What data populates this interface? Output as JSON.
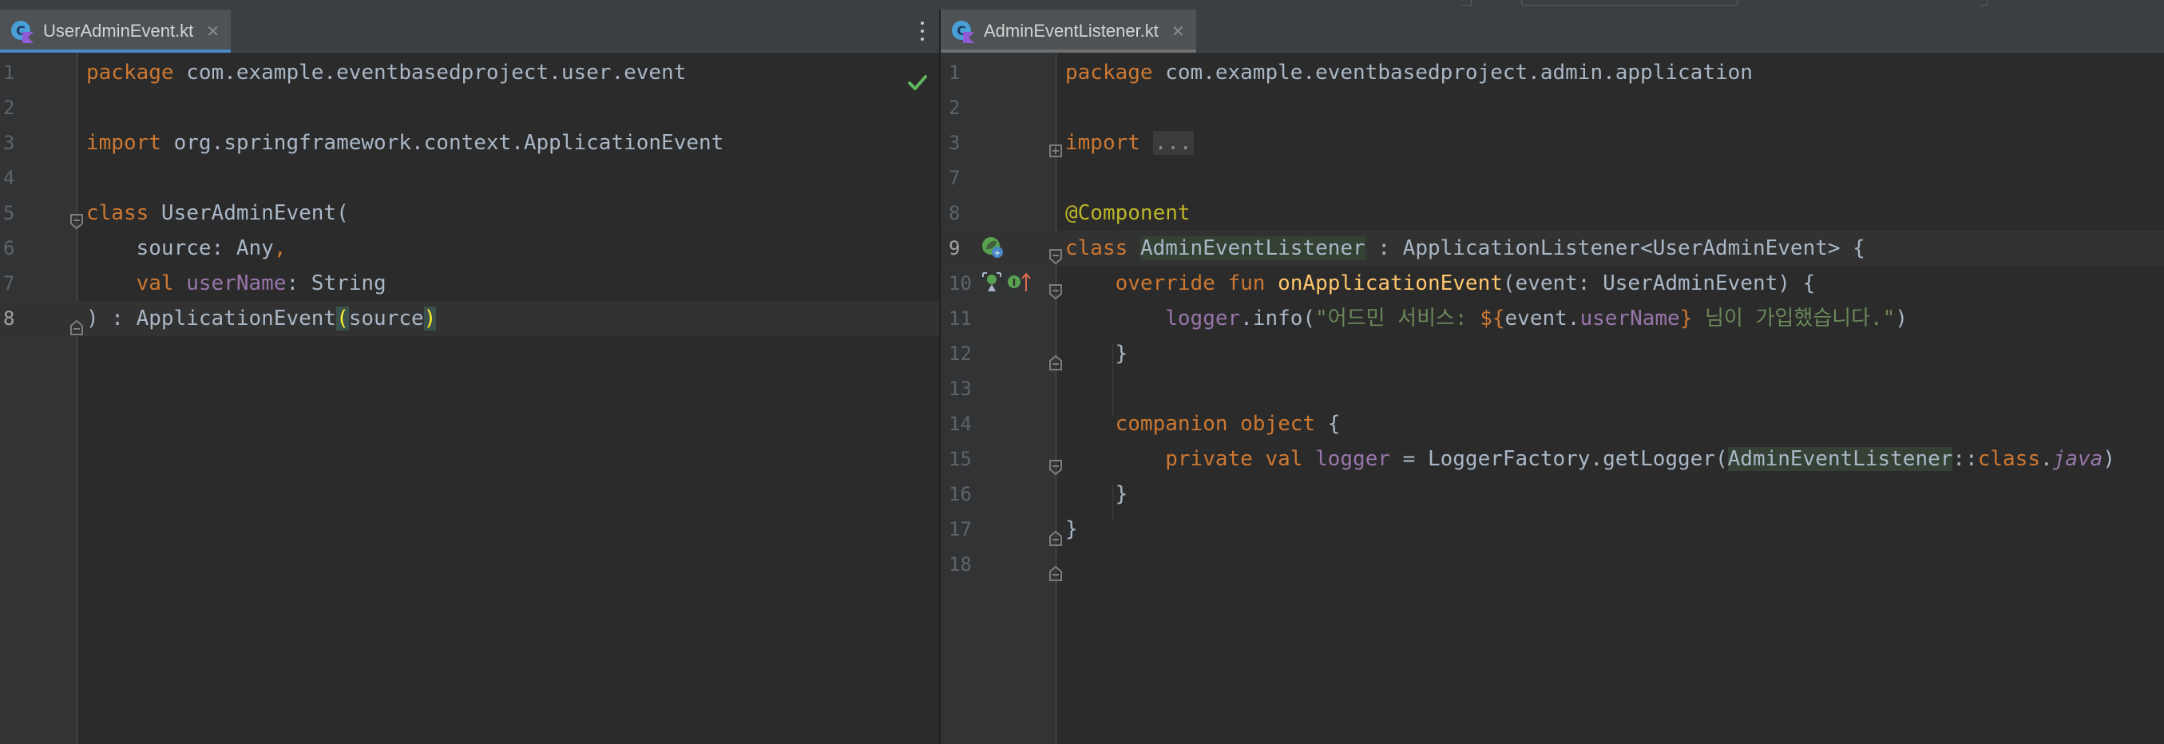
{
  "left_editor": {
    "tab": {
      "label": "UserAdminEvent.kt",
      "close": "✕"
    },
    "menu_icon": "kebab-icon",
    "inspection_status": "check-icon",
    "current_line": 8,
    "lines": [
      {
        "num": "1",
        "parts": [
          {
            "t": "package",
            "c": "kw"
          },
          {
            "t": " com.example.eventbasedproject.user.event",
            "c": ""
          }
        ]
      },
      {
        "num": "2",
        "parts": []
      },
      {
        "num": "3",
        "parts": [
          {
            "t": "import",
            "c": "kw"
          },
          {
            "t": " org.springframework.context.ApplicationEvent",
            "c": ""
          }
        ]
      },
      {
        "num": "4",
        "parts": []
      },
      {
        "num": "5",
        "parts": [
          {
            "t": "class",
            "c": "kw"
          },
          {
            "t": " UserAdminEvent(",
            "c": ""
          }
        ]
      },
      {
        "num": "6",
        "parts": [
          {
            "t": "    source: Any",
            "c": ""
          },
          {
            "t": ",",
            "c": "kw"
          }
        ]
      },
      {
        "num": "7",
        "parts": [
          {
            "t": "    ",
            "c": ""
          },
          {
            "t": "val",
            "c": "kw"
          },
          {
            "t": " ",
            "c": ""
          },
          {
            "t": "userName",
            "c": "prop"
          },
          {
            "t": ": String",
            "c": ""
          }
        ]
      },
      {
        "num": "8",
        "parts": [
          {
            "t": ") : ApplicationEvent",
            "c": ""
          },
          {
            "t": "(",
            "c": "brace-hl"
          },
          {
            "t": "source",
            "c": ""
          },
          {
            "t": ")",
            "c": "brace-hl"
          }
        ]
      }
    ]
  },
  "right_editor": {
    "tab": {
      "label": "AdminEventListener.kt",
      "close": "✕"
    },
    "current_line": 9,
    "gutter_icons": {
      "line9": "spring-bean-icon",
      "line10": [
        "spring-listener-icon",
        "implements-icon"
      ]
    },
    "lines": [
      {
        "num": "1",
        "parts": [
          {
            "t": "package",
            "c": "kw"
          },
          {
            "t": " com.example.eventbasedproject.admin.application",
            "c": ""
          }
        ]
      },
      {
        "num": "2",
        "parts": []
      },
      {
        "num": "3",
        "parts": [
          {
            "t": "import",
            "c": "kw"
          },
          {
            "t": " ",
            "c": ""
          },
          {
            "t": "...",
            "c": "fold-box"
          }
        ]
      },
      {
        "num": "7",
        "parts": []
      },
      {
        "num": "8",
        "parts": [
          {
            "t": "@Component",
            "c": "ann"
          }
        ]
      },
      {
        "num": "9",
        "parts": [
          {
            "t": "class",
            "c": "kw"
          },
          {
            "t": " ",
            "c": ""
          },
          {
            "t": "AdminEventListener",
            "c": "hl-decl"
          },
          {
            "t": " : ApplicationListener<UserAdminEvent> {",
            "c": ""
          }
        ]
      },
      {
        "num": "10",
        "parts": [
          {
            "t": "    ",
            "c": ""
          },
          {
            "t": "override fun",
            "c": "kw"
          },
          {
            "t": " ",
            "c": ""
          },
          {
            "t": "onApplicationEvent",
            "c": "fn"
          },
          {
            "t": "(event: UserAdminEvent) {",
            "c": ""
          }
        ]
      },
      {
        "num": "11",
        "parts": [
          {
            "t": "        ",
            "c": ""
          },
          {
            "t": "logger",
            "c": "prop"
          },
          {
            "t": ".info(",
            "c": ""
          },
          {
            "t": "\"어드민 서비스: ",
            "c": "str"
          },
          {
            "t": "${",
            "c": "kw"
          },
          {
            "t": "event.",
            "c": ""
          },
          {
            "t": "userName",
            "c": "prop"
          },
          {
            "t": "}",
            "c": "kw"
          },
          {
            "t": " 님이 가입했습니다.\"",
            "c": "str"
          },
          {
            "t": ")",
            "c": ""
          }
        ]
      },
      {
        "num": "12",
        "parts": [
          {
            "t": "    }",
            "c": ""
          }
        ]
      },
      {
        "num": "13",
        "parts": []
      },
      {
        "num": "14",
        "parts": [
          {
            "t": "    ",
            "c": ""
          },
          {
            "t": "companion object",
            "c": "kw"
          },
          {
            "t": " {",
            "c": ""
          }
        ]
      },
      {
        "num": "15",
        "parts": [
          {
            "t": "        ",
            "c": ""
          },
          {
            "t": "private val",
            "c": "kw"
          },
          {
            "t": " ",
            "c": ""
          },
          {
            "t": "logger",
            "c": "prop"
          },
          {
            "t": " = LoggerFactory.getLogger(",
            "c": ""
          },
          {
            "t": "AdminEventListener",
            "c": "hl-decl"
          },
          {
            "t": "::",
            "c": ""
          },
          {
            "t": "class",
            "c": "kw"
          },
          {
            "t": ".",
            "c": ""
          },
          {
            "t": "java",
            "c": "prop it"
          },
          {
            "t": ")",
            "c": ""
          }
        ]
      },
      {
        "num": "16",
        "parts": [
          {
            "t": "    }",
            "c": ""
          }
        ]
      },
      {
        "num": "17",
        "parts": [
          {
            "t": "}",
            "c": ""
          }
        ]
      },
      {
        "num": "18",
        "parts": []
      }
    ]
  },
  "colors": {
    "keyword": "#cc7832",
    "function": "#ffc66d",
    "string": "#6a8759",
    "property": "#9876aa",
    "annotation": "#bbb529",
    "default_text": "#a9b7c6",
    "editor_bg": "#2b2b2b",
    "tab_underline": "#4a88c7"
  }
}
